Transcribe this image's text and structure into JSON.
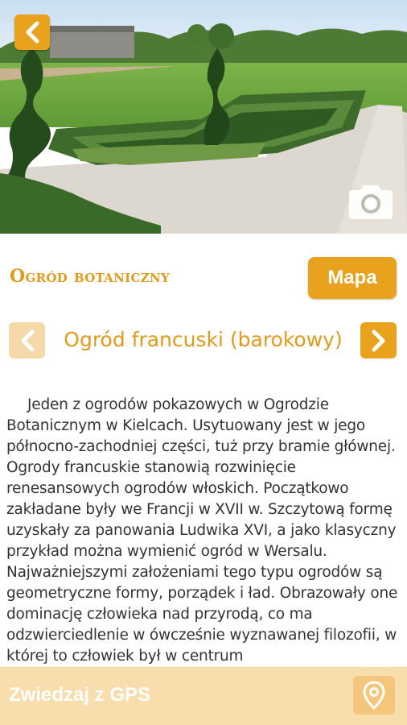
{
  "header": {
    "title": "Ogród botaniczny",
    "map_button_label": "Mapa"
  },
  "hero": {
    "back_icon": "chevron-left-icon",
    "camera_icon": "camera-icon"
  },
  "subheader": {
    "title": "Ogród francuski (barokowy)",
    "prev_icon": "chevron-left-icon",
    "next_icon": "chevron-right-icon"
  },
  "content": {
    "text": "Jeden z ogrodów pokazowych w Ogrodzie Botanicznym w Kielcach. Usytuowany jest w jego północno-zachodniej części, tuż przy bramie głównej. Ogrody francuskie stanowią rozwinięcie renesansowych ogrodów włoskich. Początkowo zakładane były we Francji w XVII w. Szczytową formę uzyskały za panowania Ludwika XVI, a jako klasyczny przykład można wymienić ogród w Wersalu. Najważniejszymi założeniami tego typu ogrodów są geometryczne formy, porządek i ład. Obrazowały one dominację człowieka nad przyrodą, co ma odzwierciedlenie w ówcześnie wyznawanej filozofii, w której to człowiek był w centrum"
  },
  "footer": {
    "gps_label": "Zwiedzaj z GPS",
    "gps_icon": "location-pin-icon"
  },
  "colors": {
    "accent": "#e8a21e",
    "accent_light": "#f6d9a8",
    "footer_bg": "#f8ddad",
    "title_text": "#e09a1c",
    "body_text": "#333333"
  }
}
